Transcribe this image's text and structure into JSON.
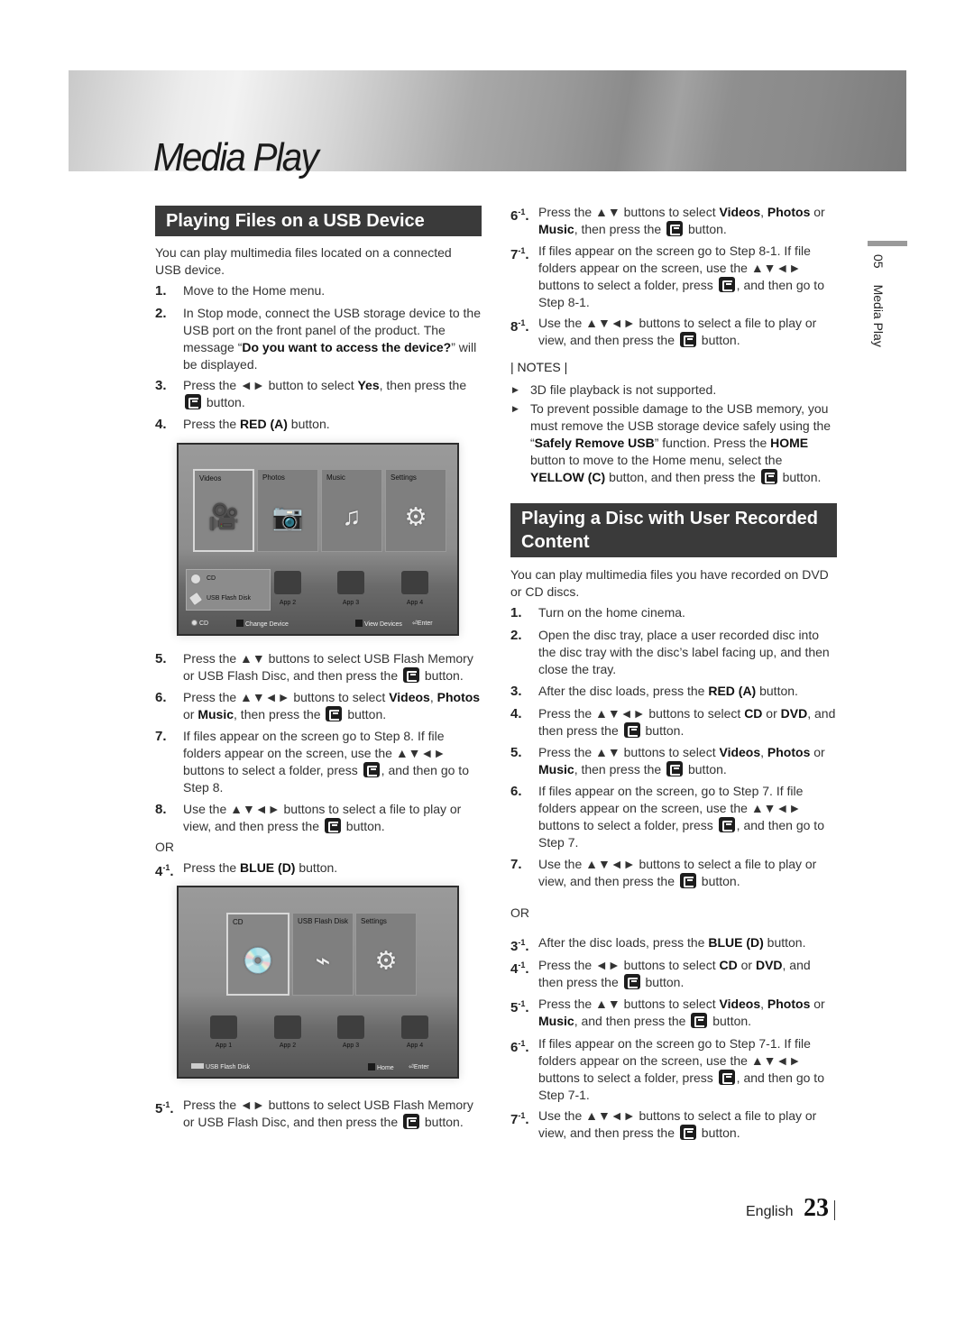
{
  "header": {
    "title": "Media Play"
  },
  "side_tab": {
    "chapter": "05",
    "label": "Media Play"
  },
  "footer": {
    "language": "English",
    "page_number": "23"
  },
  "left": {
    "section_title": "Playing Files on a USB Device",
    "intro": "You can play multimedia files located on a connected USB device.",
    "steps": [
      {
        "num": "1.",
        "text": "Move to the Home menu."
      },
      {
        "num": "2.",
        "pre": "In Stop mode, connect the USB storage device to the USB port on the front panel of the product. The message “",
        "bold": "Do you want to access the device?",
        "post": "” will be displayed."
      },
      {
        "num": "3.",
        "pre": "Press the ◄► button to select ",
        "bold": "Yes",
        "post": ", then press the",
        "post2": "button."
      },
      {
        "num": "4.",
        "pre": "Press the ",
        "bold": "RED (A)",
        "post": " button."
      },
      {
        "num": "5.",
        "pre": "Press the ▲▼ buttons to select USB Flash Memory or USB Flash Disc, and then press the",
        "post": "button."
      },
      {
        "num": "6.",
        "pre": "Press the ▲▼◄► buttons to select ",
        "b1": "Videos",
        "m1": ", ",
        "b2": "Photos",
        "m2": " or ",
        "b3": "Music",
        "post": ", then press the",
        "post2": "button."
      },
      {
        "num": "7.",
        "pre": "If files appear on the screen go to Step 8. If file folders appear on the screen, use the ▲▼◄► buttons to select a folder, press",
        "post": ", and then go to Step 8."
      },
      {
        "num": "8.",
        "pre": "Use the ▲▼◄► buttons to select a file to play or view, and then press the",
        "post": "button."
      }
    ],
    "or_label": "OR",
    "alt_steps": [
      {
        "num": "4",
        "sup": "-1",
        "pre": "Press the ",
        "bold": "BLUE (D)",
        "post": " button."
      },
      {
        "num": "5",
        "sup": "-1",
        "pre": "Press the ◄► buttons to select USB Flash Memory or USB Flash Disc, and then press the",
        "post": "button."
      }
    ],
    "screen1": {
      "tiles": [
        "Videos",
        "Photos",
        "Music",
        "Settings"
      ],
      "devices": [
        "CD",
        "USB Flash Disk"
      ],
      "apps": [
        "App 2",
        "App 3",
        "App 4"
      ],
      "bar": {
        "device": "CD",
        "a_label": "Change Device",
        "d_label": "View Devices",
        "enter": "Enter",
        "a_key": "A",
        "d_key": "D"
      }
    },
    "screen2": {
      "tiles": [
        "CD",
        "USB Flash Disk",
        "Settings"
      ],
      "apps": [
        "App 1",
        "App 2",
        "App 3",
        "App 4"
      ],
      "bar": {
        "device": "USB Flash Disk",
        "home": "Home",
        "enter": "Enter",
        "d_key": "D"
      }
    }
  },
  "right": {
    "cont_steps": [
      {
        "num": "6",
        "sup": "-1",
        "pre": "Press the ▲▼ buttons to select ",
        "b1": "Videos",
        "m1": ", ",
        "b2": "Photos",
        "m2": " or ",
        "b3": "Music",
        "post": ", then press the",
        "post2": "button."
      },
      {
        "num": "7",
        "sup": "-1",
        "text": "If files appear on the screen go to Step 8-1. If file folders appear on the screen, use the ▲▼◄► buttons to select a folder, press",
        "post": ", and then go to Step 8-1."
      },
      {
        "num": "8",
        "sup": "-1",
        "pre": "Use the ▲▼◄► buttons to select a file to play or view, and then press the",
        "post": "button."
      }
    ],
    "notes_title": "| NOTES |",
    "notes": [
      {
        "text": "3D file playback is not supported."
      },
      {
        "pre": "To prevent possible damage to the USB memory, you must remove the USB storage device safely using the “",
        "b1": "Safely Remove USB",
        "m1": "” function. Press the ",
        "b2": "HOME",
        "m2": " button to move to the Home menu, select the ",
        "b3": "YELLOW (C)",
        "post": " button, and then press the",
        "post2": "button."
      }
    ],
    "section_title": "Playing a Disc with User Recorded Content",
    "intro": "You can play multimedia files you have recorded on DVD or CD discs.",
    "steps": [
      {
        "num": "1.",
        "text": "Turn on the home cinema."
      },
      {
        "num": "2.",
        "text": "Open the disc tray, place a user recorded disc into the disc tray with the disc’s label facing up, and then close the tray."
      },
      {
        "num": "3.",
        "pre": "After the disc loads, press the ",
        "bold": "RED (A)",
        "post": " button."
      },
      {
        "num": "4.",
        "pre": "Press the ▲▼◄► buttons to select ",
        "b1": "CD",
        "m1": " or ",
        "b2": "DVD",
        "post": ", and then press the",
        "post2": "button."
      },
      {
        "num": "5.",
        "pre": "Press the ▲▼ buttons to select ",
        "b1": "Videos",
        "m1": ", ",
        "b2": "Photos",
        "m2": " or ",
        "b3": "Music",
        "post": ", then press the",
        "post2": "button."
      },
      {
        "num": "6.",
        "pre": "If files appear on the screen, go to Step 7. If file folders appear on the screen, use the ▲▼◄► buttons to select a folder, press",
        "post": ", and then go to Step 7."
      },
      {
        "num": "7.",
        "pre": "Use the ▲▼◄► buttons to select a file to play or view, and then press the",
        "post": "button."
      }
    ],
    "or_label": "OR",
    "alt_steps": [
      {
        "num": "3",
        "sup": "-1",
        "pre": "After the disc loads, press the ",
        "bold": "BLUE (D)",
        "post": " button."
      },
      {
        "num": "4",
        "sup": "-1",
        "pre": "Press the ◄► buttons to select ",
        "b1": "CD",
        "m1": " or ",
        "b2": "DVD",
        "post": ", and then press the",
        "post2": "button."
      },
      {
        "num": "5",
        "sup": "-1",
        "pre": "Press the ▲▼ buttons to select ",
        "b1": "Videos",
        "m1": ", ",
        "b2": "Photos",
        "m2": " or ",
        "b3": "Music",
        "post": ", and then press the",
        "post2": "button."
      },
      {
        "num": "6",
        "sup": "-1",
        "pre": "If files appear on the screen go to Step 7-1. If file folders appear on the screen, use the ▲▼◄► buttons to select a folder, press",
        "post": ", and then go to Step 7-1."
      },
      {
        "num": "7",
        "sup": "-1",
        "pre": "Use the ▲▼◄► buttons to select a file to play or view, and then press the",
        "post": "button."
      }
    ]
  }
}
